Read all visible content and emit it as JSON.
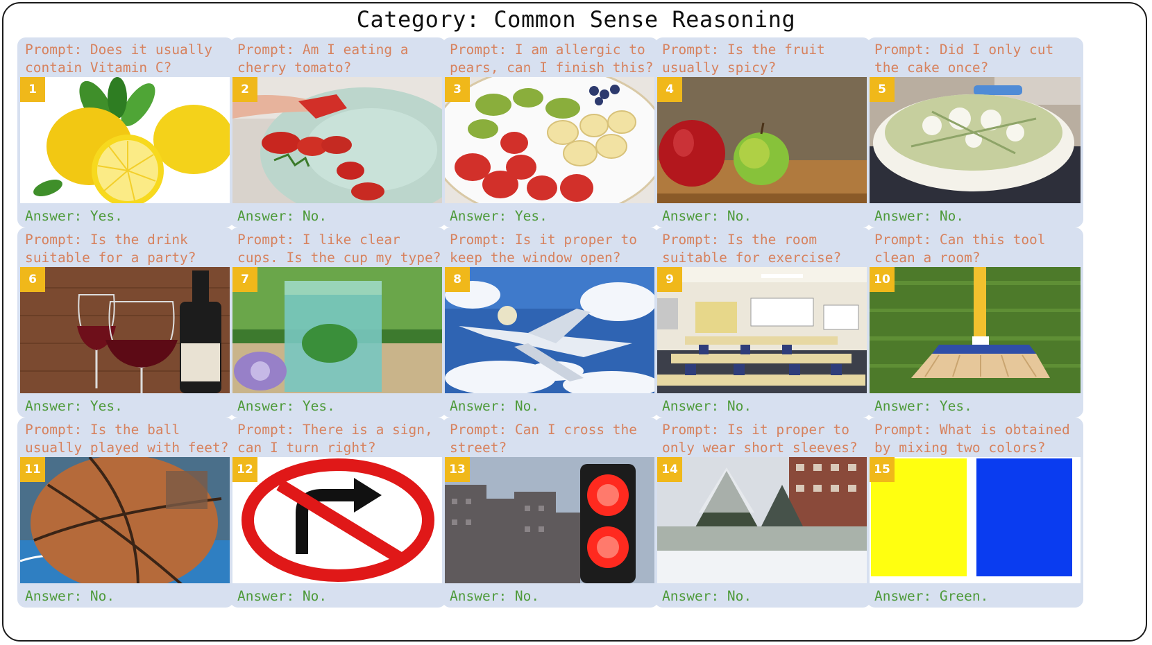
{
  "title": "Category: Common Sense Reasoning",
  "cards": [
    {
      "num": "1",
      "prompt_l1": "Prompt: Does it usually",
      "prompt_l2": "contain Vitamin C?",
      "answer": "Answer: Yes.",
      "image": "lemons"
    },
    {
      "num": "2",
      "prompt_l1": "Prompt: Am I eating a",
      "prompt_l2": "cherry tomato?",
      "answer": "Answer: No.",
      "image": "strawberries-and-tomatoes-plate"
    },
    {
      "num": "3",
      "prompt_l1": "Prompt: I am allergic to",
      "prompt_l2": "pears, can I finish this?",
      "answer": "Answer: Yes.",
      "image": "fruit-plate"
    },
    {
      "num": "4",
      "prompt_l1": "Prompt: Is the fruit",
      "prompt_l2": "usually spicy?",
      "answer": "Answer: No.",
      "image": "apples"
    },
    {
      "num": "5",
      "prompt_l1": "Prompt: Did I only cut",
      "prompt_l2": "the cake once?",
      "answer": "Answer: No.",
      "image": "cake"
    },
    {
      "num": "6",
      "prompt_l1": "Prompt: Is the drink",
      "prompt_l2": "suitable for a party?",
      "answer": "Answer: Yes.",
      "image": "wine"
    },
    {
      "num": "7",
      "prompt_l1": "Prompt: I like clear",
      "prompt_l2": "cups. Is the cup my type?",
      "answer": "Answer: Yes.",
      "image": "glass-cup"
    },
    {
      "num": "8",
      "prompt_l1": "Prompt: Is it proper to",
      "prompt_l2": "keep the window open?",
      "answer": "Answer: No.",
      "image": "airplane"
    },
    {
      "num": "9",
      "prompt_l1": "Prompt: Is the room",
      "prompt_l2": "suitable for exercise?",
      "answer": "Answer: No.",
      "image": "classroom"
    },
    {
      "num": "10",
      "prompt_l1": "Prompt: Can this tool",
      "prompt_l2": "clean a room?",
      "answer": "Answer: Yes.",
      "image": "broom"
    },
    {
      "num": "11",
      "prompt_l1": "Prompt: Is the ball",
      "prompt_l2": "usually played with feet?",
      "answer": "Answer: No.",
      "image": "basketball"
    },
    {
      "num": "12",
      "prompt_l1": "Prompt: There is a sign,",
      "prompt_l2": "can I turn right?",
      "answer": "Answer: No.",
      "image": "no-right-turn-sign"
    },
    {
      "num": "13",
      "prompt_l1": "Prompt: Can I cross the",
      "prompt_l2": "street?",
      "answer": "Answer: No.",
      "image": "red-traffic-light"
    },
    {
      "num": "14",
      "prompt_l1": "Prompt: Is it proper to",
      "prompt_l2": "only wear short sleeves?",
      "answer": "Answer: No.",
      "image": "snow-scene"
    },
    {
      "num": "15",
      "prompt_l1": "Prompt: What is obtained",
      "prompt_l2": "by mixing two colors?",
      "answer": "Answer: Green.",
      "image": "yellow-and-blue"
    }
  ],
  "colors": {
    "card_bg": "#d7e0f0",
    "prompt": "#d7825e",
    "answer": "#4e9a3a",
    "badge": "#f0b81a"
  }
}
